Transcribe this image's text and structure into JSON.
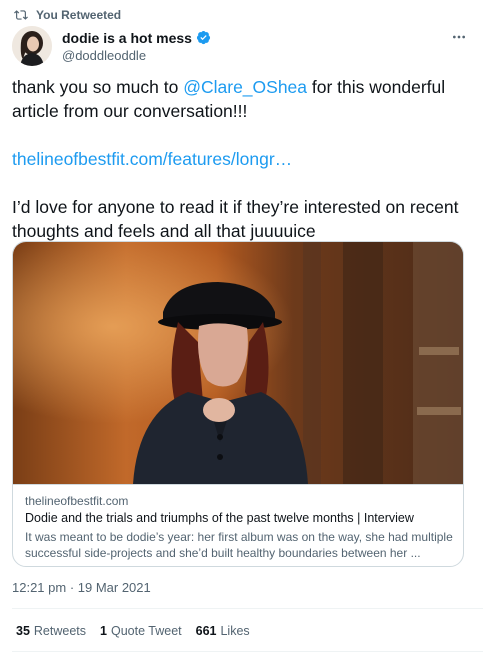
{
  "retweet": {
    "label": "You Retweeted",
    "icon": "retweet-icon"
  },
  "author": {
    "display_name": "dodie is a hot mess",
    "handle": "@doddleoddle",
    "verified_icon": "verified-badge-icon",
    "more_icon": "more-options-icon"
  },
  "tweet": {
    "line1_prefix": "thank you so much to ",
    "mention": "@Clare_OShea",
    "line1_suffix": " for this wonderful article from our conversation!!!",
    "link": "thelineofbestfit.com/features/longr…",
    "body": "I’d love for anyone to read it if they’re interested on recent thoughts and feels and all that juuuuice"
  },
  "card": {
    "domain": "thelineofbestfit.com",
    "title": "Dodie and the trials and triumphs of the past twelve months | Interview",
    "description": "It was meant to be dodie’s year: her first album was on the way, she had multiple successful side-projects and she’d built healthy boundaries between her ..."
  },
  "timestamp": "12:21 pm · 19 Mar 2021",
  "stats": {
    "retweets_count": "35",
    "retweets_label": "Retweets",
    "quotes_count": "1",
    "quotes_label": "Quote Tweet",
    "likes_count": "661",
    "likes_label": "Likes"
  },
  "colors": {
    "link": "#1d9bf0",
    "secondary_text": "#536471",
    "border": "#cfd9de"
  }
}
